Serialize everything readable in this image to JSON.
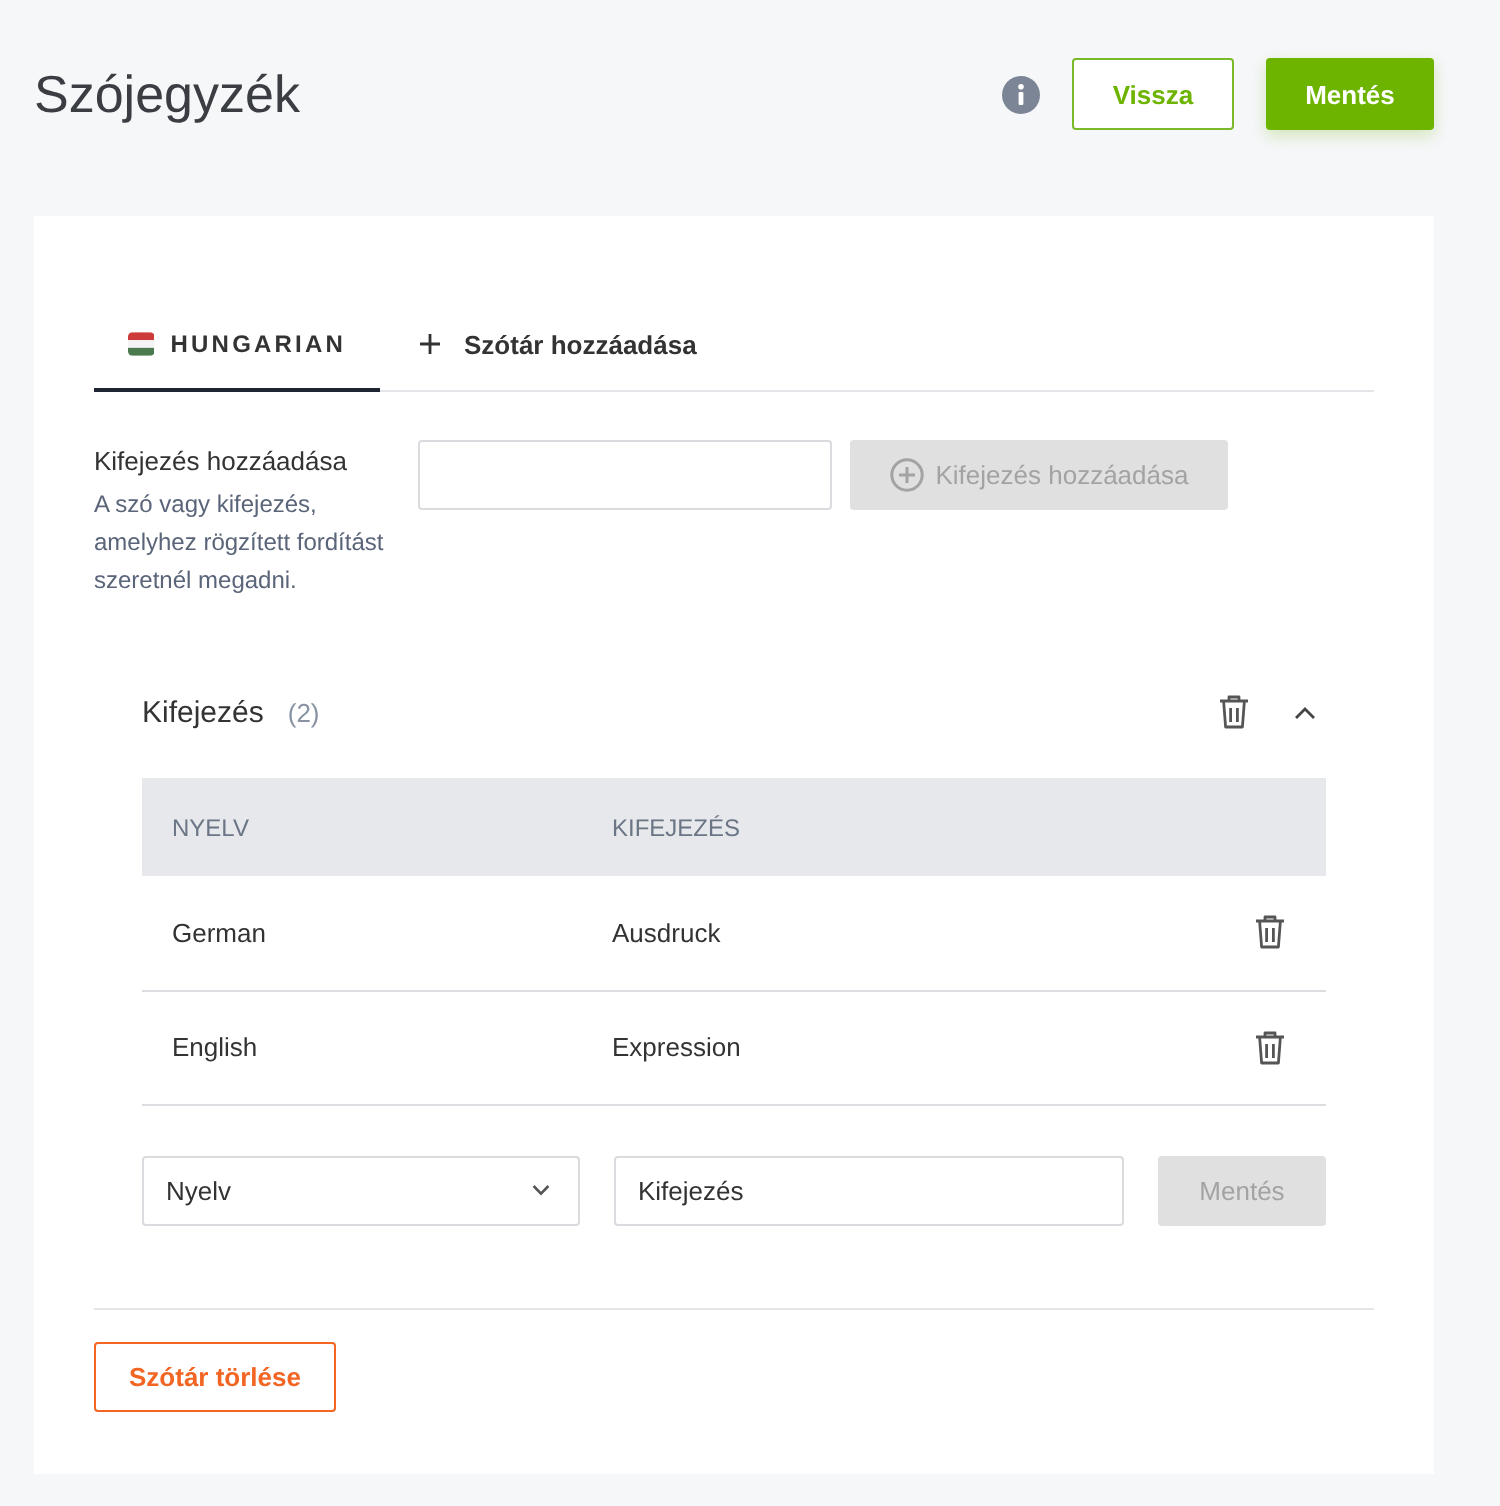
{
  "header": {
    "title": "Szójegyzék",
    "buttons": [
      {
        "label": "Vissza",
        "kind": "outline"
      },
      {
        "label": "Mentés",
        "kind": "primary"
      }
    ]
  },
  "tabs": [
    {
      "label": "HUNGARIAN",
      "kind": "language",
      "selected": true
    },
    {
      "label": "Szótár hozzáadása",
      "kind": "add",
      "selected": false
    }
  ],
  "add_expression": {
    "label": "Kifejezés hozzáadása",
    "description": "A szó vagy kifejezés, amelyhez rögzített fordítást szeretnél megadni.",
    "button": {
      "label": "Kifejezés hozzáadása",
      "disabled": true
    }
  },
  "expression_group": {
    "title": "Kifejezés",
    "count": "(2)",
    "expanded": true,
    "table": {
      "columns": [
        "NYELV",
        "KIFEJEZÉS"
      ],
      "rows": [
        [
          "German",
          "Ausdruck"
        ],
        [
          "English",
          "Expression"
        ]
      ]
    },
    "new_row": {
      "language_select": {
        "placeholder": "Nyelv"
      },
      "expression_field": {
        "placeholder": "Kifejezés"
      },
      "save_button": {
        "label": "Mentés",
        "disabled": true
      }
    }
  },
  "delete_button": {
    "label": "Szótár törlése"
  }
}
